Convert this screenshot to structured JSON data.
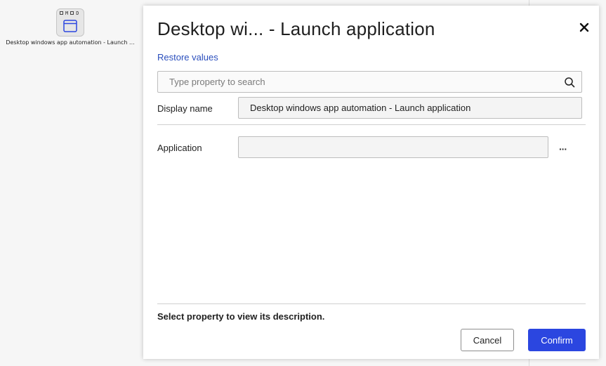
{
  "canvas": {
    "node": {
      "badges": [
        "M",
        "D"
      ],
      "label": "Desktop windows app automation - Launch ..."
    }
  },
  "dialog": {
    "title": "Desktop wi... - Launch application",
    "restore_label": "Restore values",
    "search": {
      "placeholder": "Type property to search",
      "value": ""
    },
    "properties": [
      {
        "label": "Display name",
        "value": "Desktop windows app automation - Launch application"
      },
      {
        "label": "Application",
        "value": ""
      }
    ],
    "more_label": "···",
    "description": "Select property to view its description.",
    "cancel_label": "Cancel",
    "confirm_label": "Confirm"
  },
  "colors": {
    "accent": "#2b46e0",
    "link": "#2b4fbd"
  }
}
